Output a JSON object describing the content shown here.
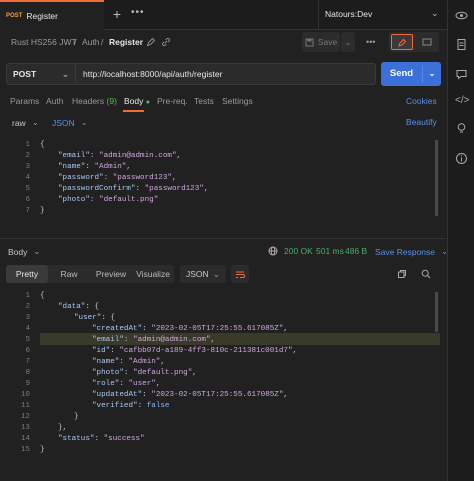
{
  "tab": {
    "method": "POST",
    "title": "Register"
  },
  "env": {
    "name": "Natours:Dev"
  },
  "breadcrumb": {
    "collection": "Rust HS256 JWT",
    "folder": "Auth",
    "request": "Register",
    "sep": "/"
  },
  "toolbar": {
    "save_label": "Save"
  },
  "request": {
    "method": "POST",
    "url": "http://localhost:8000/api/auth/register",
    "send_label": "Send"
  },
  "req_tabs": {
    "params": "Params",
    "auth": "Auth",
    "headers": "Headers",
    "headers_count": "(9)",
    "body": "Body",
    "prereq": "Pre-req.",
    "tests": "Tests",
    "settings": "Settings",
    "cookies": "Cookies"
  },
  "body_opts": {
    "mode": "raw",
    "format": "JSON",
    "beautify": "Beautify"
  },
  "request_body": {
    "lines": [
      "1",
      "2",
      "3",
      "4",
      "5",
      "6",
      "7"
    ],
    "email_key": "\"email\"",
    "email_val": "\"admin@admin.com\"",
    "name_key": "\"name\"",
    "name_val": "\"Admin\"",
    "password_key": "\"password\"",
    "password_val": "\"password123\"",
    "confirm_key": "\"passwordConfirm\"",
    "confirm_val": "\"password123\"",
    "photo_key": "\"photo\"",
    "photo_val": "\"default.png\""
  },
  "response": {
    "label": "Body",
    "status": "200 OK",
    "time": "501 ms",
    "size": "486 B",
    "save": "Save Response",
    "tabs": {
      "pretty": "Pretty",
      "raw": "Raw",
      "preview": "Preview",
      "visualize": "Visualize"
    },
    "format": "JSON",
    "lines": [
      "1",
      "2",
      "3",
      "4",
      "5",
      "6",
      "7",
      "8",
      "9",
      "10",
      "11",
      "12",
      "13",
      "14",
      "15",
      "16"
    ],
    "data_key": "\"data\"",
    "user_key": "\"user\"",
    "createdAt_key": "\"createdAt\"",
    "createdAt_val": "\"2023-02-05T17:25:55.617085Z\"",
    "email_key": "\"email\"",
    "email_val": "\"admin@admin.com\"",
    "id_key": "\"id\"",
    "id_val": "\"cafbb07d-a189-4ff3-810c-211381c001d7\"",
    "name_key": "\"name\"",
    "name_val": "\"Admin\"",
    "photo_key": "\"photo\"",
    "photo_val": "\"default.png\"",
    "role_key": "\"role\"",
    "role_val": "\"user\"",
    "updatedAt_key": "\"updatedAt\"",
    "updatedAt_val": "\"2023-02-05T17:25:55.617085Z\"",
    "verified_key": "\"verified\"",
    "verified_val": "false",
    "status_key": "\"status\"",
    "status_val": "\"success\""
  }
}
